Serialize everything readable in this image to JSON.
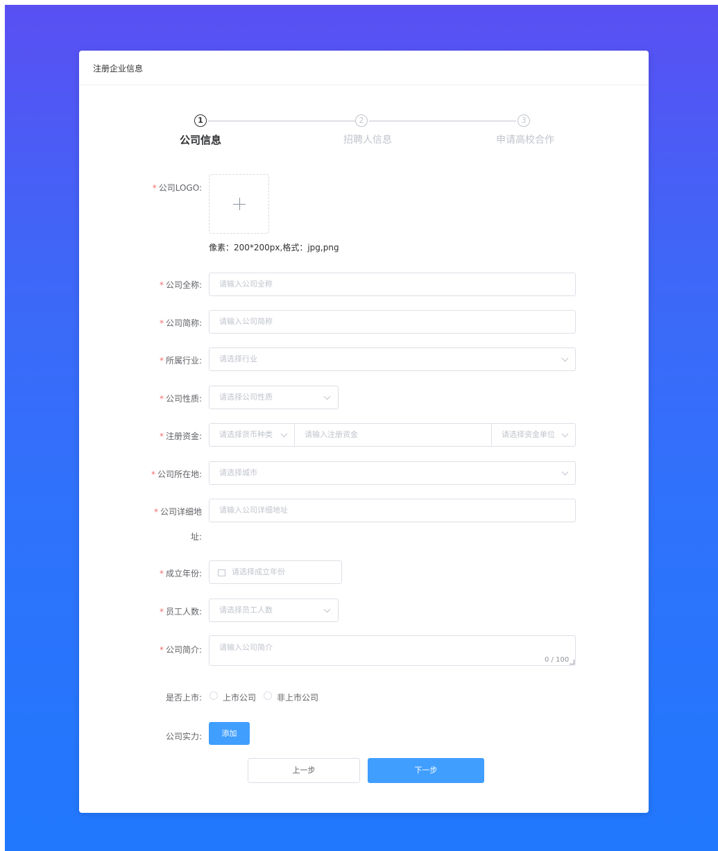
{
  "card": {
    "title": "注册企业信息"
  },
  "steps": [
    {
      "number": "1",
      "title": "公司信息",
      "active": true
    },
    {
      "number": "2",
      "title": "招聘人信息",
      "active": false
    },
    {
      "number": "3",
      "title": "申请高校合作",
      "active": false
    }
  ],
  "form": {
    "logo": {
      "label": "公司LOGO:",
      "hint": "像素：200*200px,格式：jpg,png"
    },
    "full_name": {
      "label": "公司全称:",
      "placeholder": "请输入公司全称"
    },
    "short_name": {
      "label": "公司简称:",
      "placeholder": "请输入公司简称"
    },
    "industry": {
      "label": "所属行业:",
      "placeholder": "请选择行业"
    },
    "nature": {
      "label": "公司性质:",
      "placeholder": "请选择公司性质"
    },
    "capital": {
      "label": "注册资金:",
      "currency_placeholder": "请选择货币种类",
      "amount_placeholder": "请输入注册资金",
      "unit_placeholder": "请选择资金单位"
    },
    "city": {
      "label": "公司所在地:",
      "placeholder": "请选择城市"
    },
    "address": {
      "label_line1": "公司详细地",
      "label_line2": "址:",
      "placeholder": "请输入公司详细地址"
    },
    "founded": {
      "label": "成立年份:",
      "placeholder": "请选择成立年份"
    },
    "employees": {
      "label": "员工人数:",
      "placeholder": "请选择员工人数"
    },
    "intro": {
      "label": "公司简介:",
      "placeholder": "请输入公司简介",
      "counter": "0 / 100"
    },
    "listed": {
      "label": "是否上市:",
      "options": [
        "上市公司",
        "非上市公司"
      ]
    },
    "strength": {
      "label": "公司实力:",
      "add_label": "添加"
    }
  },
  "buttons": {
    "prev": "上一步",
    "next": "下一步"
  },
  "colors": {
    "primary": "#409eff",
    "required": "#f56c6c"
  },
  "icons": {
    "upload": "plus-icon",
    "date": "calendar-icon",
    "select": "chevron-down-icon"
  }
}
